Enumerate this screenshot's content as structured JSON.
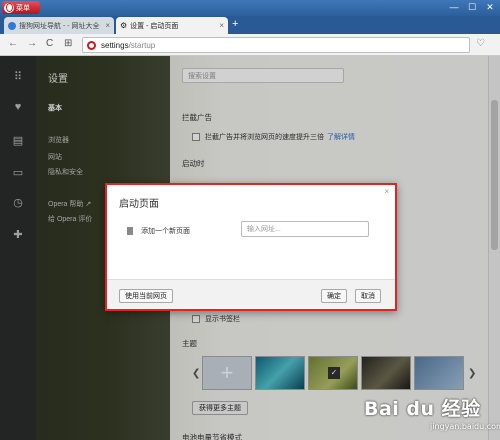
{
  "window": {
    "menu_label": "菜单",
    "controls": [
      "—",
      "☐",
      "✕"
    ]
  },
  "tabs": [
    {
      "label": "搜狗网址导航 - - 网址大全",
      "active": false
    },
    {
      "label": "设置 - 启动页面",
      "active": true
    }
  ],
  "tab_close": "×",
  "new_tab": "+",
  "address": {
    "back": "←",
    "forward": "→",
    "reload": "C",
    "grid": "⊞",
    "url_host": "settings",
    "url_path": "/startup",
    "bookmark": "♡"
  },
  "sidebar": {
    "title": "设置",
    "items": [
      {
        "label": "基本",
        "active": true
      },
      {
        "label": "浏览器",
        "active": false
      },
      {
        "label": "网站",
        "active": false
      },
      {
        "label": "隐私和安全",
        "active": false
      },
      {
        "label": "Opera 帮助 ↗",
        "active": false
      },
      {
        "label": "给 Opera 评价",
        "active": false
      }
    ]
  },
  "content": {
    "search_placeholder": "搜索设置",
    "section_adblock": "拦截广告",
    "adblock_text": "拦截广告并将浏览网页的速度提升三倍",
    "adblock_link": "了解详情",
    "section_startup": "启动时",
    "show_bookmarks": "显示书签栏",
    "section_theme": "主题",
    "more_themes": "获得更多主题",
    "next_section": "电池电量节省模式"
  },
  "dialog": {
    "title": "启动页面",
    "close": "×",
    "add_page_label": "添加一个新页面",
    "url_placeholder": "输入网址...",
    "use_current": "使用当前网页",
    "ok": "确定",
    "cancel": "取消"
  },
  "watermark": {
    "main": "Bai du 经验",
    "sub": "jingyan.baidu.com"
  }
}
